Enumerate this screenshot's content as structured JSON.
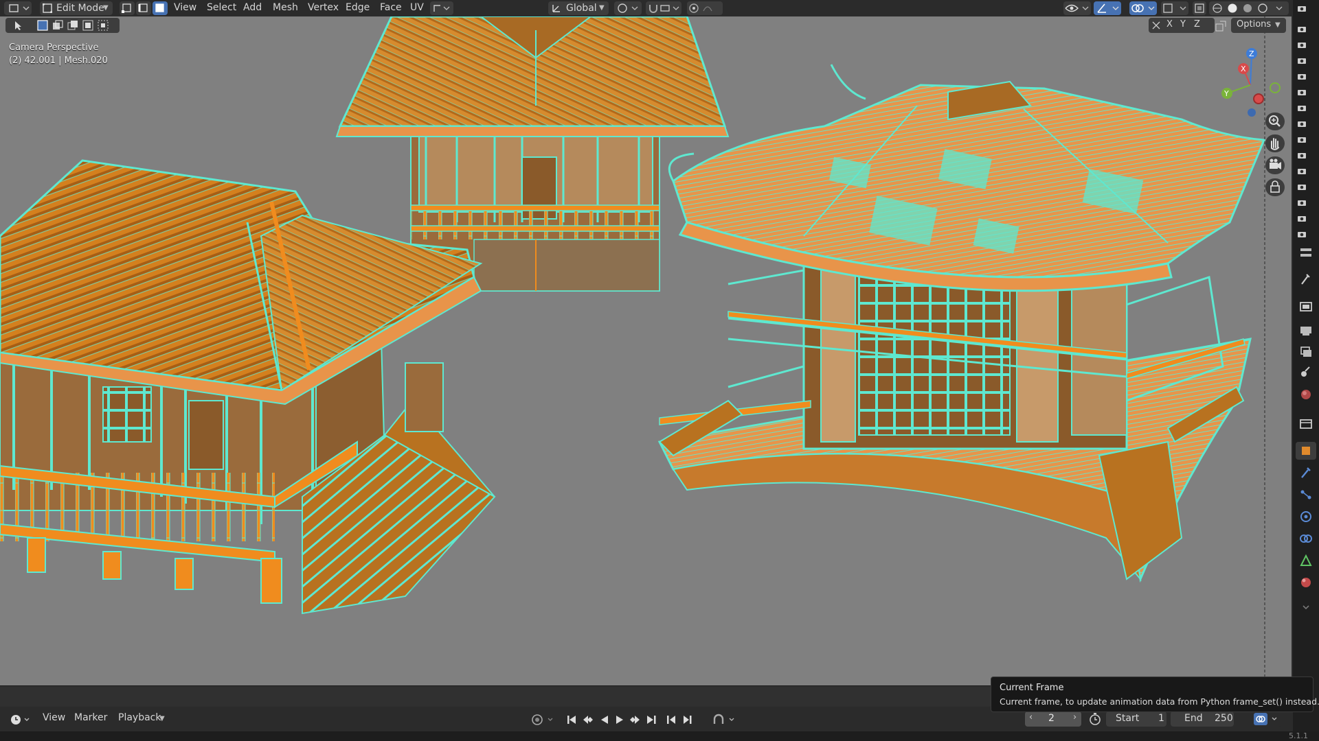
{
  "header": {
    "mode_label": "Edit Mode",
    "menu": [
      "View",
      "Select",
      "Add",
      "Mesh",
      "Vertex",
      "Edge",
      "Face",
      "UV"
    ],
    "transform_orientation": "Global",
    "options_label": "Options",
    "axis_labels": [
      "X",
      "Y",
      "Z"
    ]
  },
  "viewport": {
    "view_name": "Camera Perspective",
    "object_info": "(2) 42.001 | Mesh.020",
    "gizmo_axes": [
      "Z",
      "X",
      "Y"
    ]
  },
  "timeline": {
    "menu": [
      "View",
      "Marker",
      "Playback"
    ],
    "current_frame": "2",
    "start_label": "Start",
    "start_value": "1",
    "end_label": "End",
    "end_value": "250"
  },
  "tooltip": {
    "title": "Current Frame",
    "description": "Current frame, to update animation data from Python frame_set() instead."
  },
  "statusbar": {
    "version": "5.1.1"
  },
  "colors": {
    "viewport_bg": "#808080",
    "selected_face": "#f08c1e",
    "selected_edge": "#5ee8d0",
    "active_button": "#4772b3",
    "header_bg": "#2b2b2b"
  },
  "icons": {
    "editor_type": "editor-type-icon",
    "select_box": "select-box-icon",
    "vertex_mode": "vertex-select-icon",
    "edge_mode": "edge-select-icon",
    "face_mode": "face-select-icon",
    "zoom": "zoom-icon",
    "pan": "hand-icon",
    "camera_view": "camera-icon",
    "lock": "lock-icon"
  }
}
